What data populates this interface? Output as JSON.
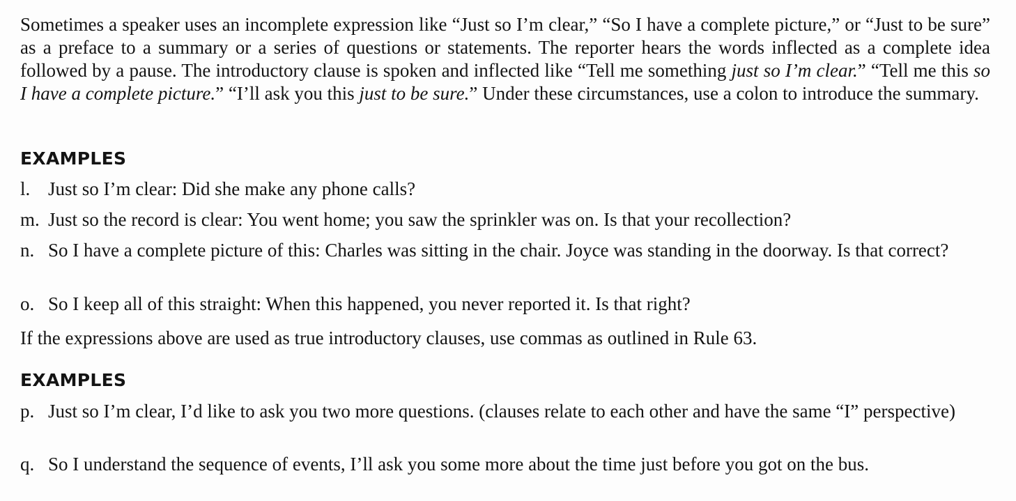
{
  "intro": {
    "s1": "Sometimes a speaker uses an incomplete expression like “Just so I’m clear,” “So I have a complete picture,” or “Just to be sure” as a preface to a summary or a series of questions or statements. The reporter hears the words inflected as a complete idea followed by a pause. The introductory clause is spoken and inflected like “Tell me something ",
    "i1": "just so I’m clear.",
    "s2": "” “Tell me this ",
    "i2": "so I have a complete picture.",
    "s3": "” “I’ll ask you this ",
    "i3": "just to be sure.",
    "s4": "” Under these circumstances, use a colon to introduce the summary."
  },
  "section1": {
    "heading": "EXAMPLES",
    "items": [
      {
        "label": "l.",
        "text": "Just so I’m clear: Did she make any phone calls?"
      },
      {
        "label": "m.",
        "text": "Just so the record is clear: You went home; you saw the sprinkler was on. Is that your recollection?"
      },
      {
        "label": "n.",
        "text": "So I have a complete picture of this: Charles was sitting in the chair. Joyce was standing in the doorway. Is that correct?"
      },
      {
        "label": "o.",
        "text": "So I keep all of this straight: When this happened, you never reported it. Is that right?"
      }
    ]
  },
  "note": "If the expressions above are used as true introductory clauses, use commas as outlined in Rule 63.",
  "section2": {
    "heading": "EXAMPLES",
    "items": [
      {
        "label": "p.",
        "text": "Just so I’m clear, I’d like to ask you two more questions. (clauses relate to each other and have the same “I” perspective)"
      },
      {
        "label": "q.",
        "text": "So I understand the sequence of events, I’ll ask you some more about the time just before you got on the bus."
      }
    ]
  }
}
